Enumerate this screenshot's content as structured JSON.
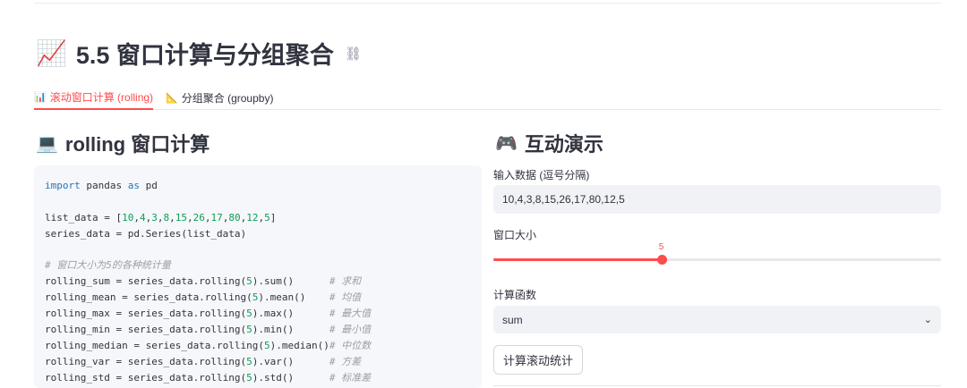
{
  "header": {
    "title_emoji": "📈",
    "title": "5.5 窗口计算与分组聚合",
    "link_icon": "link-icon"
  },
  "tabs": [
    {
      "icon": "📊",
      "label": "滚动窗口计算 (rolling)",
      "active": true
    },
    {
      "icon": "📐",
      "label": "分组聚合 (groupby)",
      "active": false
    }
  ],
  "left": {
    "title_emoji": "💻",
    "title": "rolling 窗口计算",
    "code_lines": [
      "import pandas as pd",
      "",
      "list_data = [10,4,3,8,15,26,17,80,12,5]",
      "series_data = pd.Series(list_data)",
      "",
      "# 窗口大小为5的各种统计量",
      "rolling_sum = series_data.rolling(5).sum()      # 求和",
      "rolling_mean = series_data.rolling(5).mean()    # 均值",
      "rolling_max = series_data.rolling(5).max()      # 最大值",
      "rolling_min = series_data.rolling(5).min()      # 最小值",
      "rolling_median = series_data.rolling(5).median()# 中位数",
      "rolling_var = series_data.rolling(5).var()      # 方差",
      "rolling_std = series_data.rolling(5).std()      # 标准差"
    ]
  },
  "right": {
    "title_emoji": "🎮",
    "title": "互动演示",
    "data_label": "输入数据 (逗号分隔)",
    "data_value": "10,4,3,8,15,26,17,80,12,5",
    "window_label": "窗口大小",
    "window_value": "5",
    "window_fraction": 0.375,
    "func_label": "计算函数",
    "func_value": "sum",
    "button_label": "计算滚动统计"
  },
  "colors": {
    "accent": "#ff4b4b",
    "keyword": "#1f77b4",
    "number": "#0f9d58",
    "comment": "#9aa0a6"
  }
}
